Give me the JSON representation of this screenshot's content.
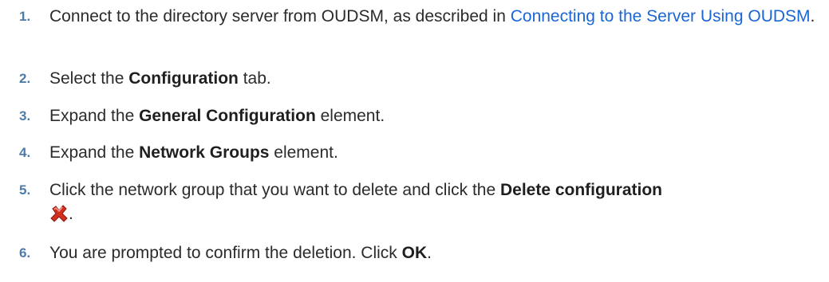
{
  "steps": [
    {
      "num": "1.",
      "pre": "Connect to the directory server from OUDSM, as described in ",
      "link": "Connecting to the Server Using OUDSM",
      "post": "."
    },
    {
      "num": "2.",
      "pre": "Select the ",
      "bold": "Configuration",
      "post": " tab."
    },
    {
      "num": "3.",
      "pre": "Expand the ",
      "bold": "General Configuration",
      "post": " element."
    },
    {
      "num": "4.",
      "pre": "Expand the ",
      "bold": "Network Groups",
      "post": " element."
    },
    {
      "num": "5.",
      "pre": "Click the network group that you want to delete and click the ",
      "bold": "Delete configuration",
      "icon": "delete-x-icon",
      "post": "."
    },
    {
      "num": "6.",
      "pre": "You are prompted to confirm the deletion. Click ",
      "bold": "OK",
      "post": "."
    }
  ],
  "colors": {
    "number": "#4f7ba8",
    "link": "#1a66d6",
    "icon_red": "#d32f1f"
  }
}
